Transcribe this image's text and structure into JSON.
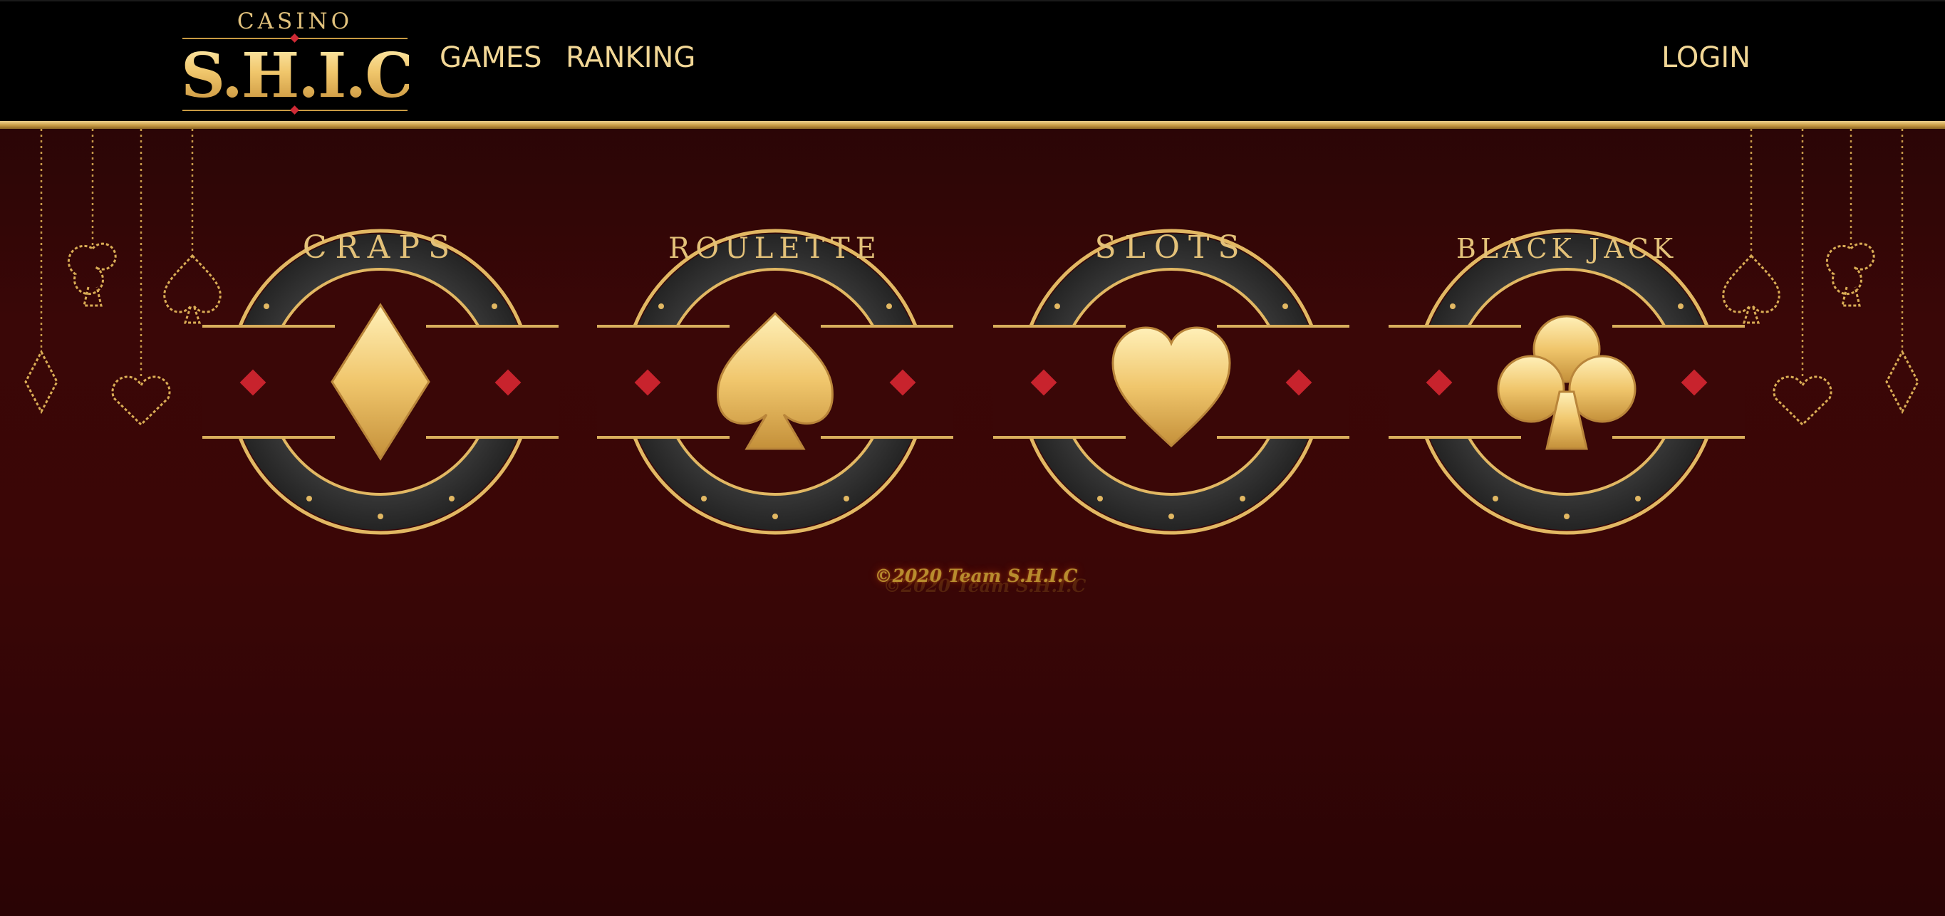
{
  "header": {
    "logo": {
      "top_text": "CASINO",
      "brand": "S.H.I.C."
    },
    "nav": [
      {
        "label": "GAMES"
      },
      {
        "label": "RANKING"
      }
    ],
    "login_label": "LOGIN"
  },
  "games": [
    {
      "label": "CRAPS",
      "suit": "diamond-icon"
    },
    {
      "label": "ROULETTE",
      "suit": "spade-icon"
    },
    {
      "label": "SLOTS",
      "suit": "heart-icon"
    },
    {
      "label": "BLACK JACK",
      "suit": "club-icon"
    }
  ],
  "footer": {
    "copyright": "©2020 Team S.H.I.C"
  },
  "colors": {
    "gold": "#e8c57a",
    "dark_gold": "#c79a43",
    "red_gem": "#c8232d",
    "background": "#3a0707",
    "header": "#000000"
  }
}
